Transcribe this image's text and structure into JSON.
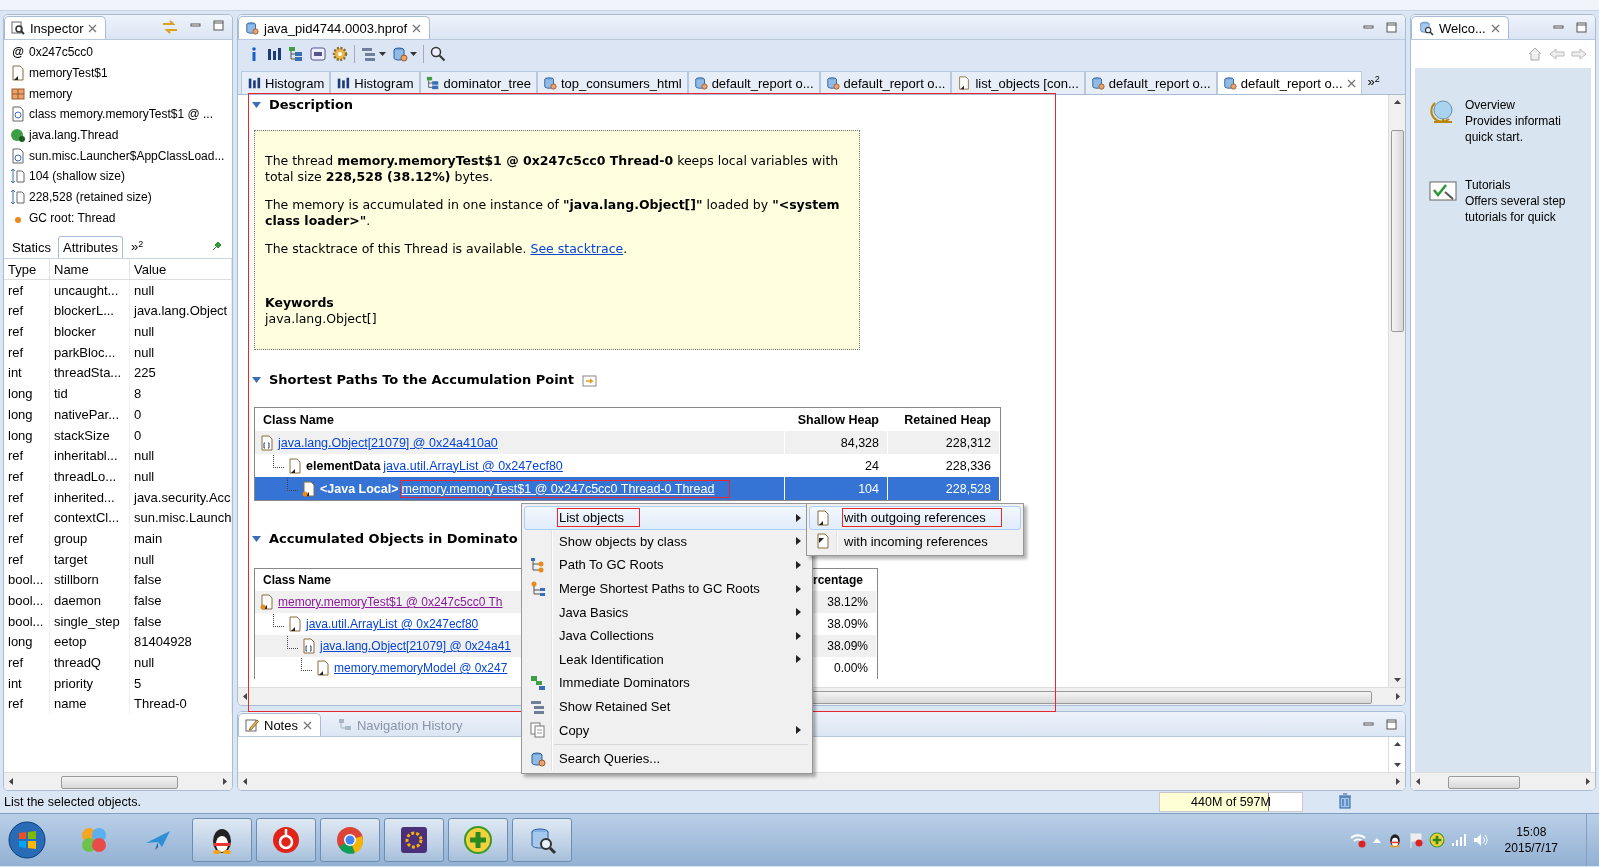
{
  "inspector": {
    "title": "Inspector",
    "items": [
      {
        "kind": "address",
        "glyph": "@",
        "text": "0x247c5cc0"
      },
      {
        "kind": "object",
        "text": "memoryTest$1"
      },
      {
        "kind": "package",
        "text": "memory"
      },
      {
        "kind": "class",
        "text": "class memory.memoryTest$1 @ ..."
      },
      {
        "kind": "superclass",
        "text": "java.lang.Thread"
      },
      {
        "kind": "loader",
        "text": "sun.misc.Launcher$AppClassLoad..."
      },
      {
        "kind": "size",
        "text": "104 (shallow size)"
      },
      {
        "kind": "size",
        "text": "228,528 (retained size)"
      },
      {
        "kind": "gcroot",
        "text": "GC root: Thread"
      }
    ],
    "tabs": [
      {
        "label": "Statics",
        "selected": false
      },
      {
        "label": "Attributes",
        "selected": true
      }
    ],
    "more": {
      "chevron": "»",
      "count": "2"
    },
    "columns": [
      "Type",
      "Name",
      "Value"
    ],
    "rows": [
      [
        "ref",
        "uncaught...",
        "null"
      ],
      [
        "ref",
        "blockerL...",
        "java.lang.Object"
      ],
      [
        "ref",
        "blocker",
        "null"
      ],
      [
        "ref",
        "parkBloc...",
        "null"
      ],
      [
        "int",
        "threadSta...",
        "225"
      ],
      [
        "long",
        "tid",
        "8"
      ],
      [
        "long",
        "nativePar...",
        "0"
      ],
      [
        "long",
        "stackSize",
        "0"
      ],
      [
        "ref",
        "inheritabl...",
        "null"
      ],
      [
        "ref",
        "threadLo...",
        "null"
      ],
      [
        "ref",
        "inherited...",
        "java.security.Acc"
      ],
      [
        "ref",
        "contextCl...",
        "sun.misc.Launch"
      ],
      [
        "ref",
        "group",
        "main"
      ],
      [
        "ref",
        "target",
        "null"
      ],
      [
        "bool...",
        "stillborn",
        "false"
      ],
      [
        "bool...",
        "daemon",
        "false"
      ],
      [
        "bool...",
        "single_step",
        "false"
      ],
      [
        "long",
        "eetop",
        "81404928"
      ],
      [
        "ref",
        "threadQ",
        "null"
      ],
      [
        "int",
        "priority",
        "5"
      ],
      [
        "ref",
        "name",
        "Thread-0"
      ]
    ]
  },
  "editor": {
    "title": "java_pid4744.0003.hprof",
    "tabs": [
      {
        "label": "Histogram",
        "kind": "histogram",
        "selected": false
      },
      {
        "label": "Histogram",
        "kind": "histogram",
        "selected": false
      },
      {
        "label": "dominator_tree",
        "kind": "tree",
        "selected": false
      },
      {
        "label": "top_consumers_html",
        "kind": "report",
        "selected": false
      },
      {
        "label": "default_report  o...",
        "kind": "report",
        "selected": false
      },
      {
        "label": "default_report  o...",
        "kind": "report",
        "selected": false
      },
      {
        "label": "list_objects [con...",
        "kind": "list",
        "selected": false
      },
      {
        "label": "default_report  o...",
        "kind": "report",
        "selected": false
      },
      {
        "label": "default_report  o...",
        "kind": "report",
        "selected": true
      }
    ],
    "more": {
      "chevron": "»",
      "count": "2"
    },
    "description": {
      "heading": "Description",
      "paragraphs": [
        "The thread **memory.memoryTest$1 @ 0x247c5cc0 Thread-0** keeps local variables with total size **228,528 (38.12%)** bytes.",
        "The memory is accumulated in one instance of **\"java.lang.Object[]\"** loaded by **\"<system class loader>\"**."
      ],
      "stack": {
        "before": "The stacktrace of this Thread is available.",
        "link": "See stacktrace",
        "after": "."
      },
      "keywords_label": "Keywords",
      "keywords": "java.lang.Object[]"
    },
    "paths": {
      "heading": "Shortest Paths To the Accumulation Point",
      "columns": [
        "Class Name",
        "Shallow Heap",
        "Retained Heap"
      ],
      "rows": [
        {
          "kind": "array",
          "prefix": "",
          "link": "java.lang.Object[21079] @ 0x24a410a0",
          "shallow": "84,328",
          "retained": "228,312",
          "selected": false,
          "annotated": false,
          "children": [
            {
              "kind": "object",
              "prefix": "elementData",
              "link": "java.util.ArrayList @ 0x247ecf80",
              "shallow": "24",
              "retained": "228,336",
              "selected": false,
              "annotated": false,
              "children": [
                {
                  "kind": "thread",
                  "prefix": "<Java Local>",
                  "link": "memory.memoryTest$1 @ 0x247c5cc0 Thread-0 Thread",
                  "shallow": "104",
                  "retained": "228,528",
                  "selected": true,
                  "annotated": true
                }
              ]
            }
          ]
        }
      ]
    },
    "accumulated": {
      "heading": "Accumulated Objects in Dominato",
      "columns": [
        "Class Name",
        "rcentage"
      ],
      "rows": [
        {
          "kind": "thread",
          "link": "memory.memoryTest$1 @ 0x247c5cc0 Th",
          "visited": true,
          "percentage": "38.12%",
          "children": [
            {
              "kind": "object",
              "link": "java.util.ArrayList @ 0x247ecf80",
              "visited": false,
              "percentage": "38.09%",
              "children": [
                {
                  "kind": "array",
                  "link": "java.lang.Object[21079] @ 0x24a41",
                  "visited": false,
                  "percentage": "38.09%",
                  "children": [
                    {
                      "kind": "object",
                      "link": "memory.memoryModel @ 0x247",
                      "visited": false,
                      "percentage": "0.00%"
                    }
                  ]
                }
              ]
            }
          ]
        }
      ]
    }
  },
  "context_menu": {
    "items": [
      {
        "label": "List objects",
        "kind": "none",
        "submenu": true,
        "selected": true,
        "annotated": true
      },
      {
        "label": "Show objects by class",
        "kind": "none",
        "submenu": true,
        "selected": false,
        "annotated": false
      },
      {
        "label": "Path To GC Roots",
        "kind": "path",
        "submenu": true,
        "selected": false,
        "annotated": false
      },
      {
        "label": "Merge Shortest Paths to GC Roots",
        "kind": "merge",
        "submenu": true,
        "selected": false,
        "annotated": false
      },
      {
        "label": "Java Basics",
        "kind": "none",
        "submenu": true,
        "selected": false,
        "annotated": false
      },
      {
        "label": "Java Collections",
        "kind": "none",
        "submenu": true,
        "selected": false,
        "annotated": false
      },
      {
        "label": "Leak Identification",
        "kind": "none",
        "submenu": true,
        "selected": false,
        "annotated": false
      },
      {
        "label": "Immediate Dominators",
        "kind": "dominators",
        "submenu": false,
        "selected": false,
        "annotated": false
      },
      {
        "label": "Show Retained Set",
        "kind": "retained",
        "submenu": false,
        "selected": false,
        "annotated": false
      },
      {
        "label": "Copy",
        "kind": "copy",
        "submenu": true,
        "selected": false,
        "annotated": false
      },
      {
        "label": "Search Queries...",
        "kind": "queries",
        "submenu": false,
        "selected": false,
        "annotated": false,
        "separator_before": true
      }
    ]
  },
  "submenu": {
    "items": [
      {
        "label": "with outgoing references",
        "kind": "outgoing",
        "selected": true,
        "annotated": true
      },
      {
        "label": "with incoming references",
        "kind": "incoming",
        "selected": false,
        "annotated": false
      }
    ]
  },
  "notes": {
    "tabs": [
      {
        "label": "Notes",
        "selected": true
      },
      {
        "label": "Navigation History",
        "selected": false
      }
    ]
  },
  "welcome": {
    "title": "Welco...",
    "items": [
      {
        "kind": "globe",
        "title": "Overview",
        "lines": [
          "Provides informati",
          "quick start."
        ]
      },
      {
        "kind": "checklist",
        "title": "Tutorials",
        "lines": [
          "Offers several step",
          "tutorials for quick"
        ]
      }
    ]
  },
  "status": {
    "message": "List the selected objects.",
    "heap": {
      "text": "440M of 597M",
      "level": 0.76
    }
  },
  "taskbar": {
    "apps": [
      {
        "kind": "balls",
        "running": false
      },
      {
        "kind": "bird",
        "running": false
      },
      {
        "kind": "penguin",
        "running": true
      },
      {
        "kind": "music",
        "running": true
      },
      {
        "kind": "browser",
        "running": true
      },
      {
        "kind": "ide",
        "running": true
      },
      {
        "kind": "plus",
        "running": true
      },
      {
        "kind": "analyzer",
        "running": true
      }
    ],
    "time": "15:08",
    "date": "2015/7/17"
  }
}
